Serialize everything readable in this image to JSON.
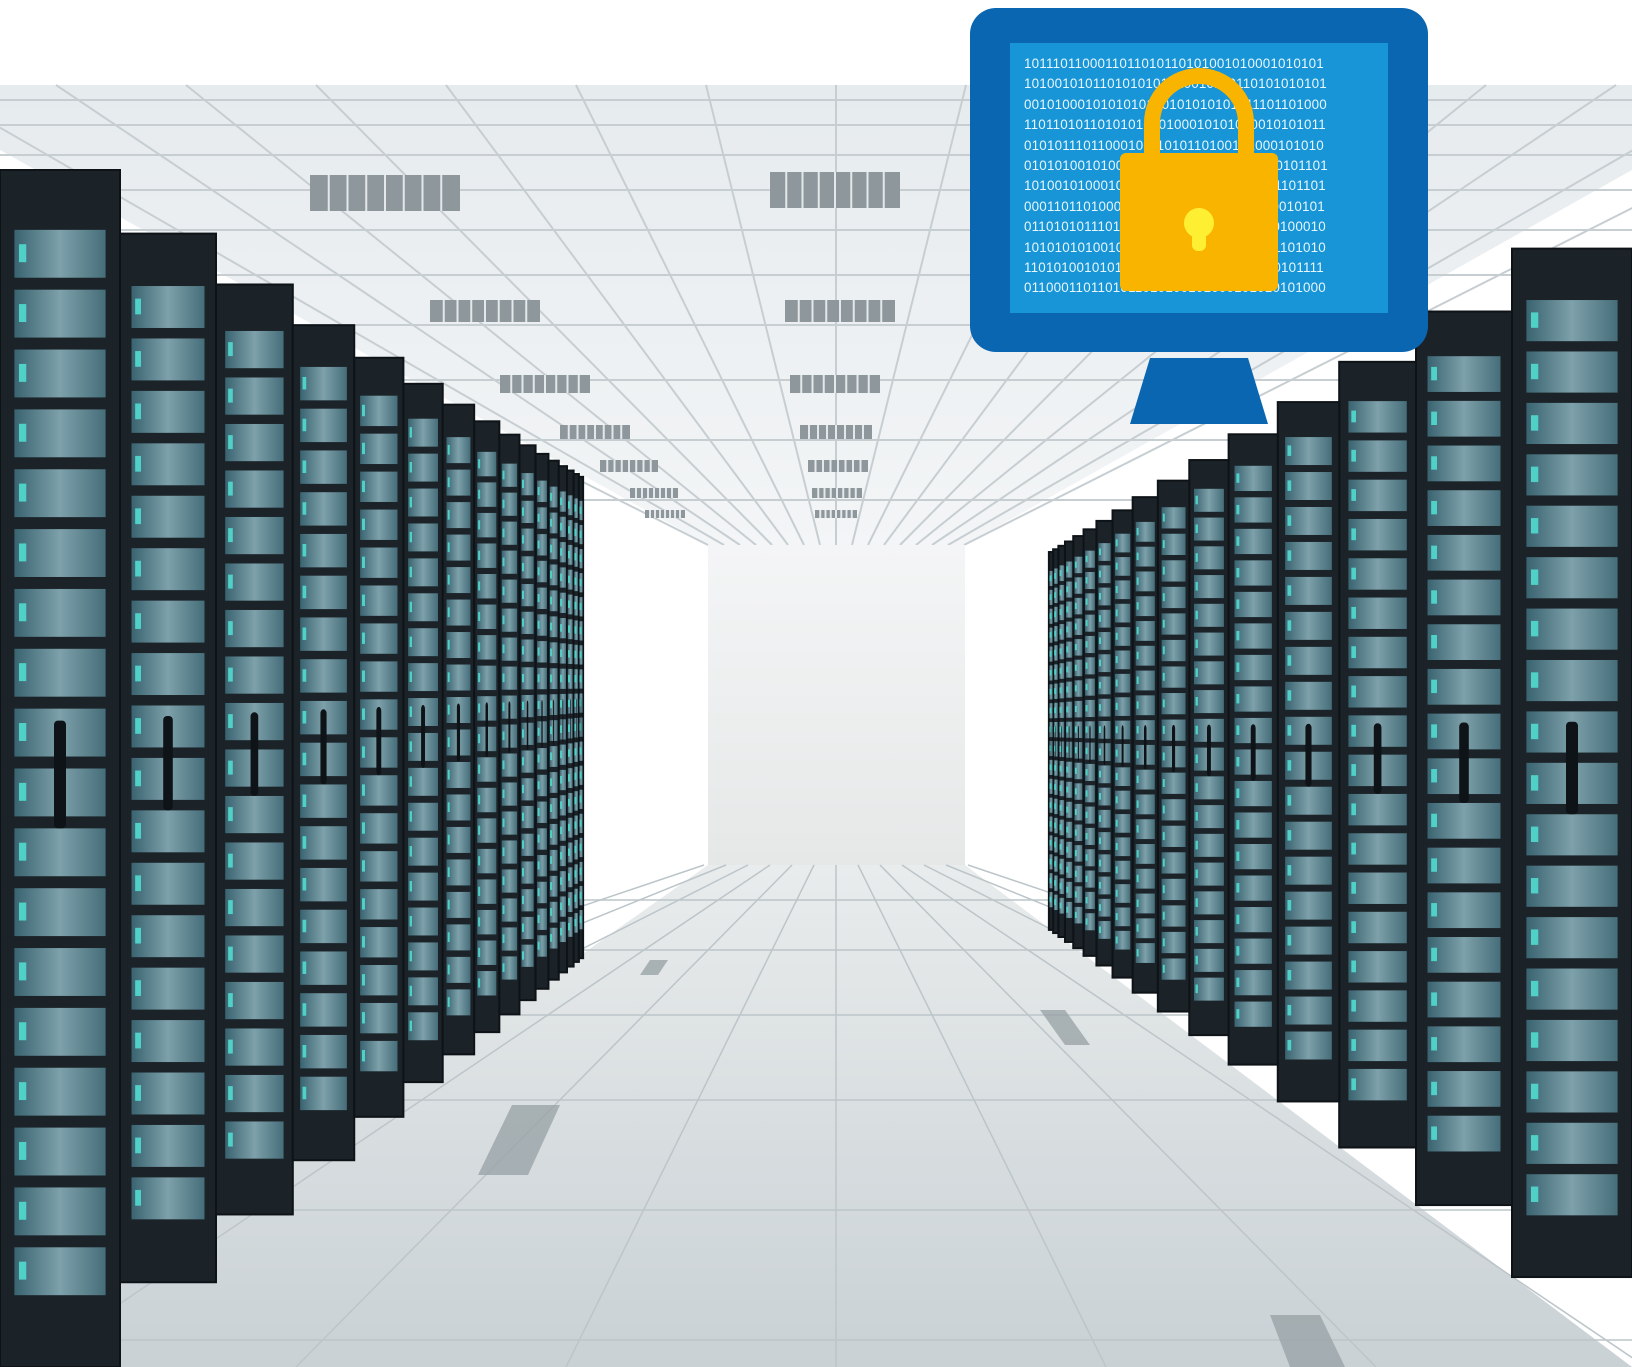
{
  "scene": {
    "subject": "data-center-corridor",
    "colors": {
      "ceiling": "#e9eef1",
      "wall": "#eef0f1",
      "floor": "#d7dde0",
      "rack": "#1b2329",
      "rack_panel": "#5c8c9a",
      "rack_led": "#4fd1c7"
    }
  },
  "overlay": {
    "icon": "monitor-padlock",
    "colors": {
      "frame": "#0b66b2",
      "screen": "#1795d6",
      "code_text": "#e8f6ff",
      "lock_body": "#f9b400",
      "keyhole": "#ffef33"
    },
    "binary_lines": [
      "1011101100011011010110101001010001010101",
      "1010010101101010101010010110110101010101",
      "0010100010101010100101010101011101101000",
      "1101101011010101010100010101010010101011",
      "0101011101100010111010110100101000101010",
      "0101010010100101010101010101011010101101",
      "1010010100010110101001010010101011101101",
      "0001101101000110110101100101001010010101",
      "0110101011101010110100010101010010100010",
      "1010101010010110100101101010001101101010",
      "1101010010101010101101010101101010101111",
      "0110001101101011010100101000101010101000"
    ]
  }
}
